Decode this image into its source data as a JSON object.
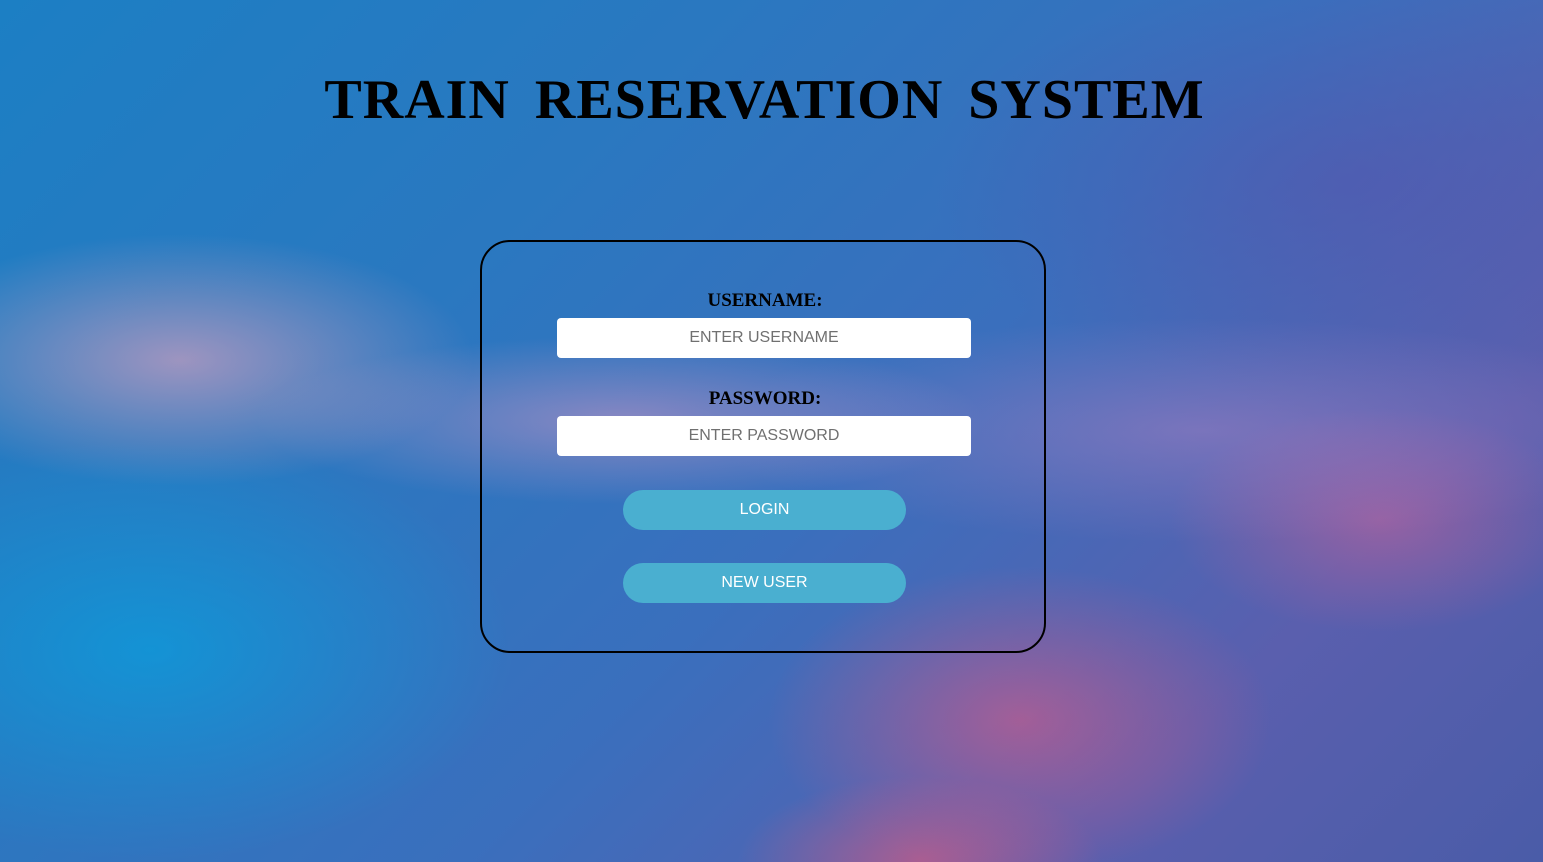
{
  "page": {
    "title": "TRAIN RESERVATION SYSTEM"
  },
  "form": {
    "username_label": "USERNAME:",
    "username_placeholder": "ENTER USERNAME",
    "username_value": "",
    "password_label": "PASSWORD:",
    "password_placeholder": "ENTER PASSWORD",
    "password_value": "",
    "login_label": "LOGIN",
    "new_user_label": "NEW USER"
  },
  "colors": {
    "button_bg": "#4aafd0",
    "button_text": "#ffffff",
    "title_text": "#000000",
    "box_border": "#000000"
  }
}
